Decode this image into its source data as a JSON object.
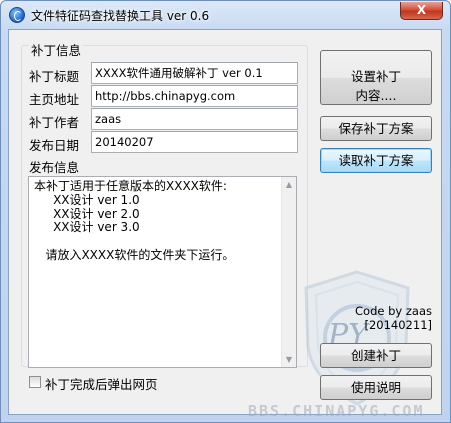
{
  "window": {
    "title": "文件特征码查找替换工具  ver 0.6",
    "close_label": "X"
  },
  "patch_info": {
    "group_label": "补丁信息",
    "fields": [
      {
        "label": "补丁标题",
        "value": "XXXX软件通用破解补丁 ver 0.1"
      },
      {
        "label": "主页地址",
        "value": "http://bbs.chinapyg.com"
      },
      {
        "label": "补丁作者",
        "value": "zaas"
      },
      {
        "label": "发布日期",
        "value": "20140207"
      }
    ],
    "release_label": "发布信息",
    "release_text": "本补丁适用于任意版本的XXXX软件:\n     XX设计 ver 1.0\n     XX设计 ver 2.0\n     XX设计 ver 3.0\n\n   请放入XXXX软件的文件夹下运行。"
  },
  "buttons": {
    "set_content_line1": "设置补丁",
    "set_content_line2": "内容....",
    "save_scheme": "保存补丁方案",
    "load_scheme": "读取补丁方案",
    "create_patch": "创建补丁",
    "help": "使用说明"
  },
  "checkbox": {
    "label": "补丁完成后弹出网页",
    "checked": false
  },
  "credit": {
    "line1": "Code by zaas",
    "line2": "[20140211]"
  },
  "watermark": {
    "text": "BBS.CHINAPYG.COM",
    "logo": "PY"
  }
}
